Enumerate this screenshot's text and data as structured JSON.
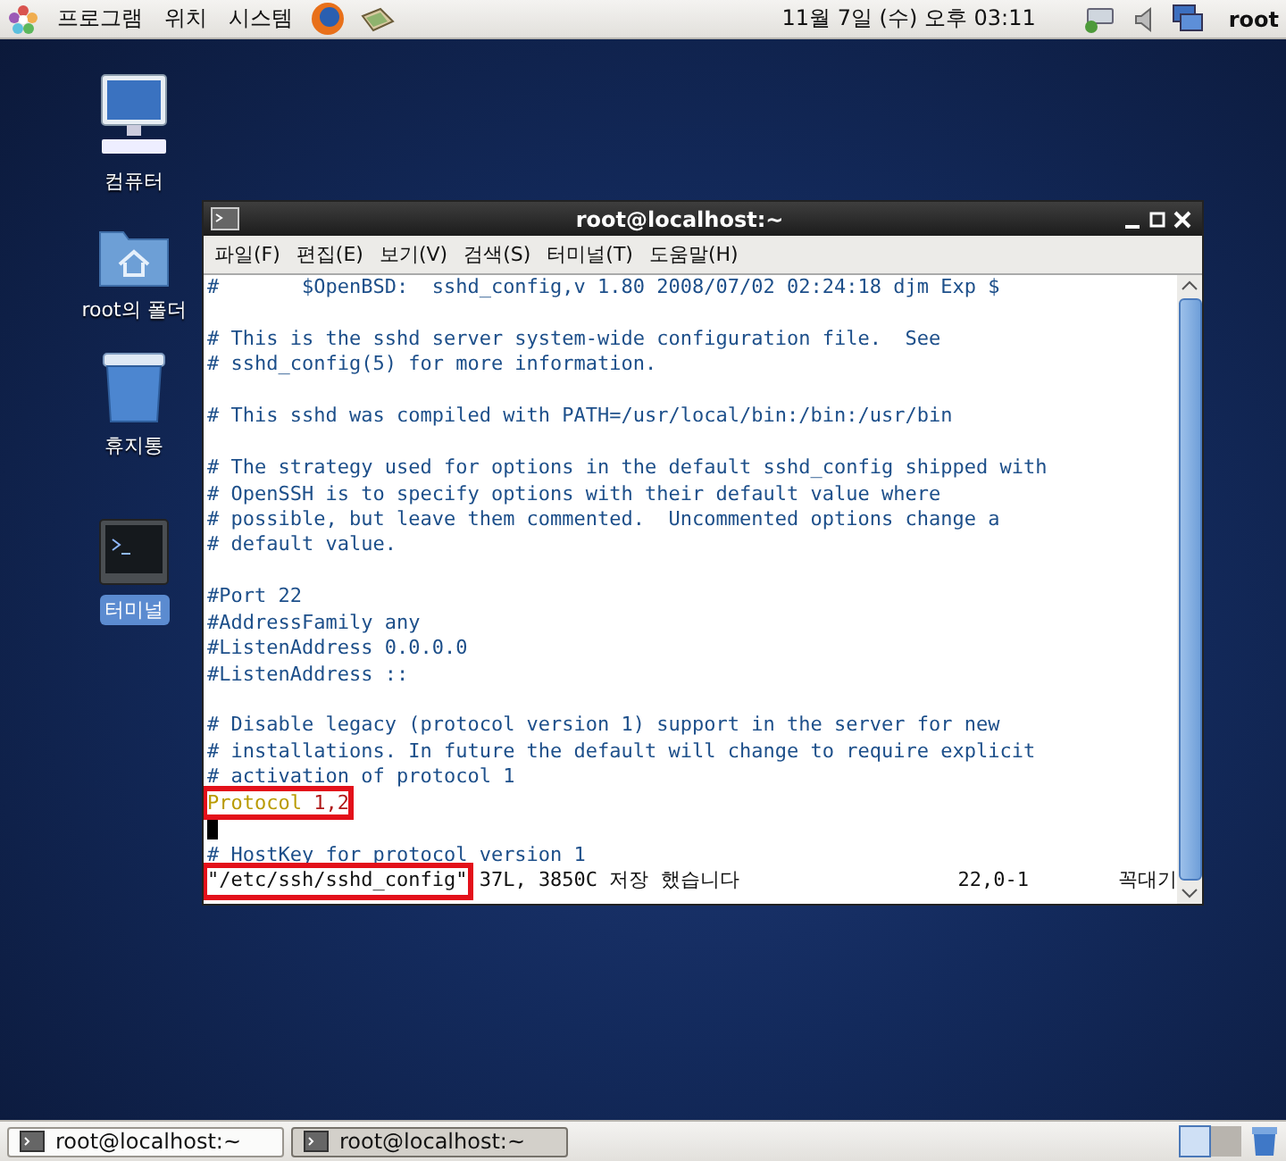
{
  "top_panel": {
    "menus": [
      "프로그램",
      "위치",
      "시스템"
    ],
    "clock": "11월  7일 (수) 오후 03:11",
    "user": "root"
  },
  "desktop_icons": [
    {
      "label": "컴퓨터",
      "kind": "computer",
      "selected": false
    },
    {
      "label": "root의 폴더",
      "kind": "folder",
      "selected": false
    },
    {
      "label": "휴지통",
      "kind": "trash",
      "selected": false
    },
    {
      "label": "터미널",
      "kind": "terminal",
      "selected": true
    }
  ],
  "window": {
    "title": "root@localhost:~",
    "menus": [
      "파일(F)",
      "편집(E)",
      "보기(V)",
      "검색(S)",
      "터미널(T)",
      "도움말(H)"
    ],
    "lines": [
      {
        "kind": "comment",
        "text": "#       $OpenBSD:  sshd_config,v 1.80 2008/07/02 02:24:18 djm Exp $"
      },
      {
        "kind": "blank"
      },
      {
        "kind": "comment",
        "text": "# This is the sshd server system-wide configuration file.  See"
      },
      {
        "kind": "comment",
        "text": "# sshd_config(5) for more information."
      },
      {
        "kind": "blank"
      },
      {
        "kind": "comment",
        "text": "# This sshd was compiled with PATH=/usr/local/bin:/bin:/usr/bin"
      },
      {
        "kind": "blank"
      },
      {
        "kind": "comment",
        "text": "# The strategy used for options in the default sshd_config shipped with"
      },
      {
        "kind": "comment",
        "text": "# OpenSSH is to specify options with their default value where"
      },
      {
        "kind": "comment",
        "text": "# possible, but leave them commented.  Uncommented options change a"
      },
      {
        "kind": "comment",
        "text": "# default value."
      },
      {
        "kind": "blank"
      },
      {
        "kind": "comment",
        "text": "#Port 22"
      },
      {
        "kind": "comment",
        "text": "#AddressFamily any"
      },
      {
        "kind": "comment",
        "text": "#ListenAddress 0.0.0.0"
      },
      {
        "kind": "comment",
        "text": "#ListenAddress ::"
      },
      {
        "kind": "blank"
      },
      {
        "kind": "comment",
        "text": "# Disable legacy (protocol version 1) support in the server for new"
      },
      {
        "kind": "comment",
        "text": "# installations. In future the default will change to require explicit"
      },
      {
        "kind": "comment",
        "text": "# activation of protocol 1"
      },
      {
        "kind": "directive",
        "keyword": "Protocol",
        "value": "1,2",
        "highlighted": true
      },
      {
        "kind": "cursor"
      },
      {
        "kind": "comment",
        "text": "# HostKey for protocol version 1"
      }
    ],
    "status": {
      "filename": "\"/etc/ssh/sshd_config\"",
      "filename_highlighted": true,
      "message": "37L, 3850C 저장 했습니다",
      "position": "22,0-1",
      "scroll": "꼭대기"
    }
  },
  "taskbar": [
    {
      "label": "root@localhost:~",
      "selected": false
    },
    {
      "label": "root@localhost:~",
      "selected": true
    }
  ]
}
